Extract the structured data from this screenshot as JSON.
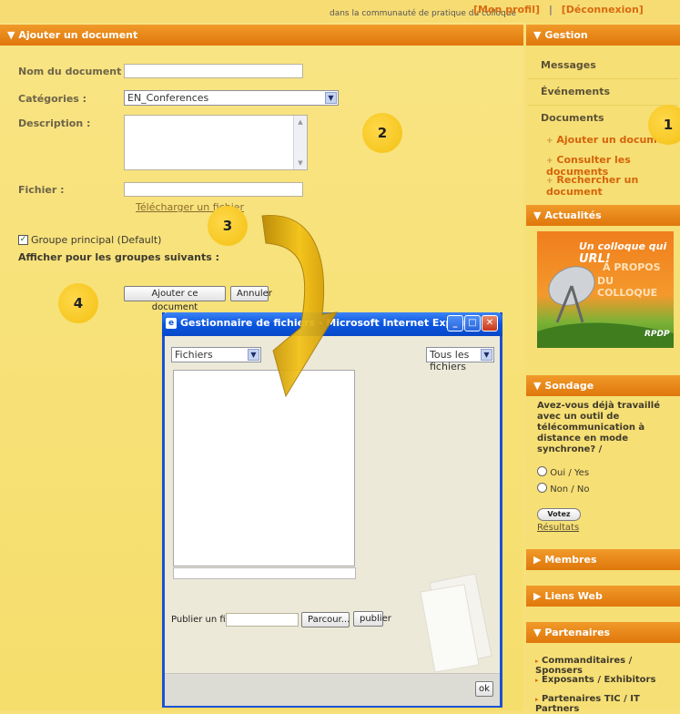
{
  "topbar": {
    "community_text": "dans la communauté de pratique du colloque",
    "profile_link": "[Mon profil]",
    "separator": "|",
    "logout_link": "[Déconnexion]"
  },
  "form": {
    "section_title": "Ajouter un document",
    "name_label": "Nom du document :",
    "name_value": "",
    "category_label": "Catégories :",
    "category_value": "EN_Conferences",
    "description_label": "Description :",
    "file_label": "Fichier :",
    "file_value": "",
    "upload_link": "Télécharger un fichier",
    "group_checkbox_label": "Groupe principal (Default)",
    "other_groups_label": "Afficher pour les groupes suivants :",
    "submit_label": "Ajouter ce document",
    "cancel_label": "Annuler"
  },
  "callouts": [
    "1",
    "2",
    "3",
    "4"
  ],
  "sidebar": {
    "gestion_title": "Gestion",
    "messages": "Messages",
    "evenements": "Événements",
    "documents": "Documents",
    "sub_links": [
      "Ajouter un document",
      "Consulter les documents",
      "Rechercher un document"
    ],
    "actualites_title": "Actualités",
    "banner_line1": "Un colloque qui",
    "banner_url": "URL!",
    "banner_line2": "À PROPOS",
    "banner_line3": "DU COLLOQUE",
    "banner_logo": "RPDP",
    "sondage_title": "Sondage",
    "poll_question": "Avez-vous déjà travaillé avec un outil de télécommunication à distance en mode synchrone? /",
    "poll_options": [
      "Oui / Yes",
      "Non / No"
    ],
    "vote_label": "Votez",
    "results_link": "Résultats",
    "membres_title": "Membres",
    "liens_title": "Liens Web",
    "partenaires_title": "Partenaires",
    "partner_links": [
      "Commanditaires / Sponsers",
      "Exposants / Exhibitors",
      "Partenaires TIC / IT Partners"
    ]
  },
  "dialog": {
    "title": "Gestionnaire de fichiers - Microsoft Internet Explorer",
    "folder_select": "Fichiers",
    "filter_select": "Tous les fichiers",
    "publish_label": "Publier un fichier:",
    "browse_label": "Parcour...",
    "publish_button": "publier",
    "ok_label": "ok"
  },
  "colors": {
    "orange_header": "#e98a1c",
    "panel_yellow": "#f7e07a",
    "xp_blue": "#0a56e0",
    "arrow_gold": "#e9b100"
  }
}
